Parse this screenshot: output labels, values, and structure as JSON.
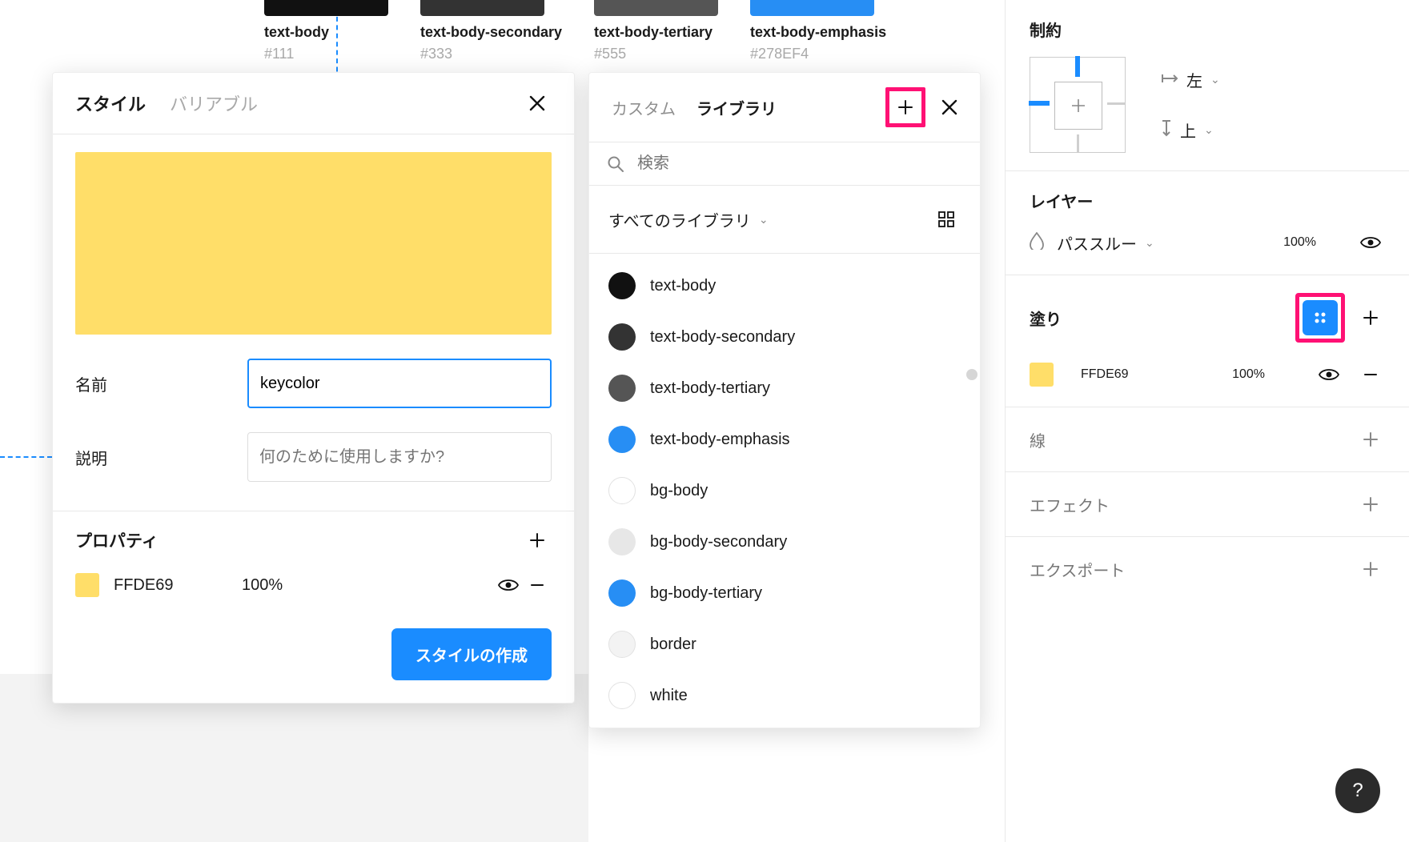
{
  "swatches": [
    {
      "name": "text-body",
      "hex": "#111",
      "color": "#111111"
    },
    {
      "name": "text-body-secondary",
      "hex": "#333",
      "color": "#333333"
    },
    {
      "name": "text-body-tertiary",
      "hex": "#555",
      "color": "#555555"
    },
    {
      "name": "text-body-emphasis",
      "hex": "#278EF4",
      "color": "#278EF4"
    }
  ],
  "styleModal": {
    "tab_style": "スタイル",
    "tab_variable": "バリアブル",
    "name_label": "名前",
    "name_value": "keycolor",
    "desc_label": "説明",
    "desc_placeholder": "何のために使用しますか?",
    "properties_title": "プロパティ",
    "color_hex": "FFDE69",
    "opacity": "100%",
    "create_button": "スタイルの作成"
  },
  "libraryModal": {
    "tab_custom": "カスタム",
    "tab_library": "ライブラリ",
    "search_placeholder": "検索",
    "filter_label": "すべてのライブラリ",
    "items": [
      {
        "label": "text-body",
        "color": "#111111"
      },
      {
        "label": "text-body-secondary",
        "color": "#333333"
      },
      {
        "label": "text-body-tertiary",
        "color": "#555555"
      },
      {
        "label": "text-body-emphasis",
        "color": "#278EF4"
      },
      {
        "label": "bg-body",
        "color": "#ffffff",
        "border": "#e2e2e2"
      },
      {
        "label": "bg-body-secondary",
        "color": "#e7e7e7"
      },
      {
        "label": "bg-body-tertiary",
        "color": "#278EF4"
      },
      {
        "label": "border",
        "color": "#f3f3f3",
        "border": "#e2e2e2"
      },
      {
        "label": "white",
        "color": "#ffffff",
        "border": "#e2e2e2"
      }
    ]
  },
  "rightPanel": {
    "constraints_title": "制約",
    "constraint_h": "左",
    "constraint_v": "上",
    "layer_title": "レイヤー",
    "blend_mode": "パススルー",
    "layer_opacity": "100%",
    "fill_title": "塗り",
    "fill_hex": "FFDE69",
    "fill_opacity": "100%",
    "stroke_title": "線",
    "effects_title": "エフェクト",
    "export_title": "エクスポート"
  },
  "help_label": "?"
}
